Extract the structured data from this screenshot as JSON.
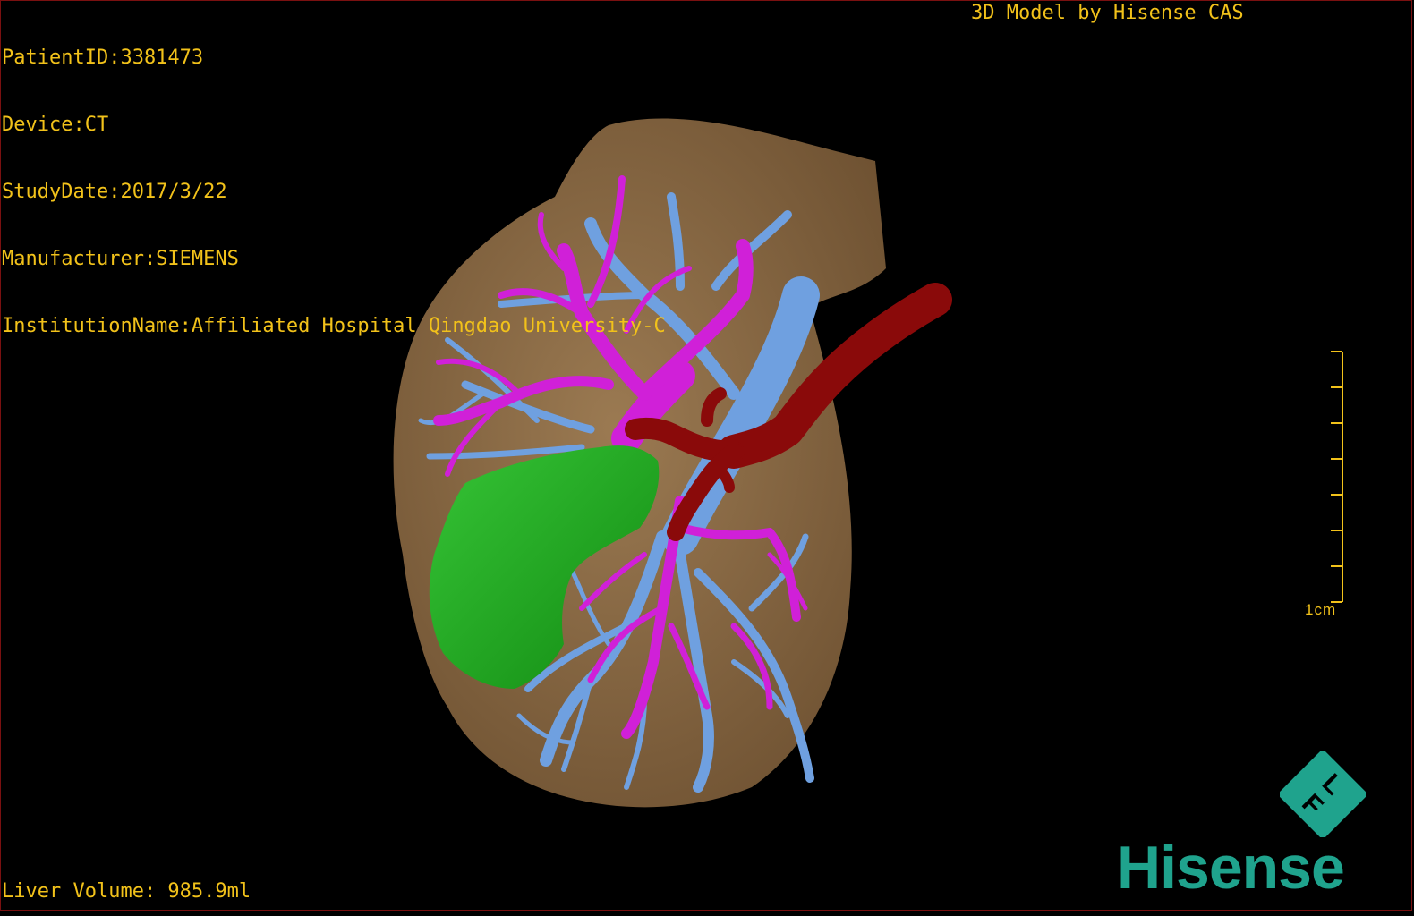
{
  "header": {
    "patient_id": "PatientID:3381473",
    "device": "Device:CT",
    "study_date": "StudyDate:2017/3/22",
    "manufacturer": "Manufacturer:SIEMENS",
    "institution": "InstitutionName:Affiliated Hospital Qingdao University-C"
  },
  "credit": "3D Model by Hisense CAS",
  "footer": {
    "liver_volume": "Liver Volume: 985.9ml"
  },
  "scale_bar": {
    "label": "1cm"
  },
  "logo": {
    "brand": "Hisense",
    "mark": "F L"
  },
  "colors": {
    "text": "#f2c21a",
    "liver": "#8b6a45",
    "portal_vein": "#6fa0e0",
    "hepatic_vein": "#d020d8",
    "artery": "#8a0a0a",
    "tumor": "#1fa51f",
    "brand": "#1fa38d"
  }
}
